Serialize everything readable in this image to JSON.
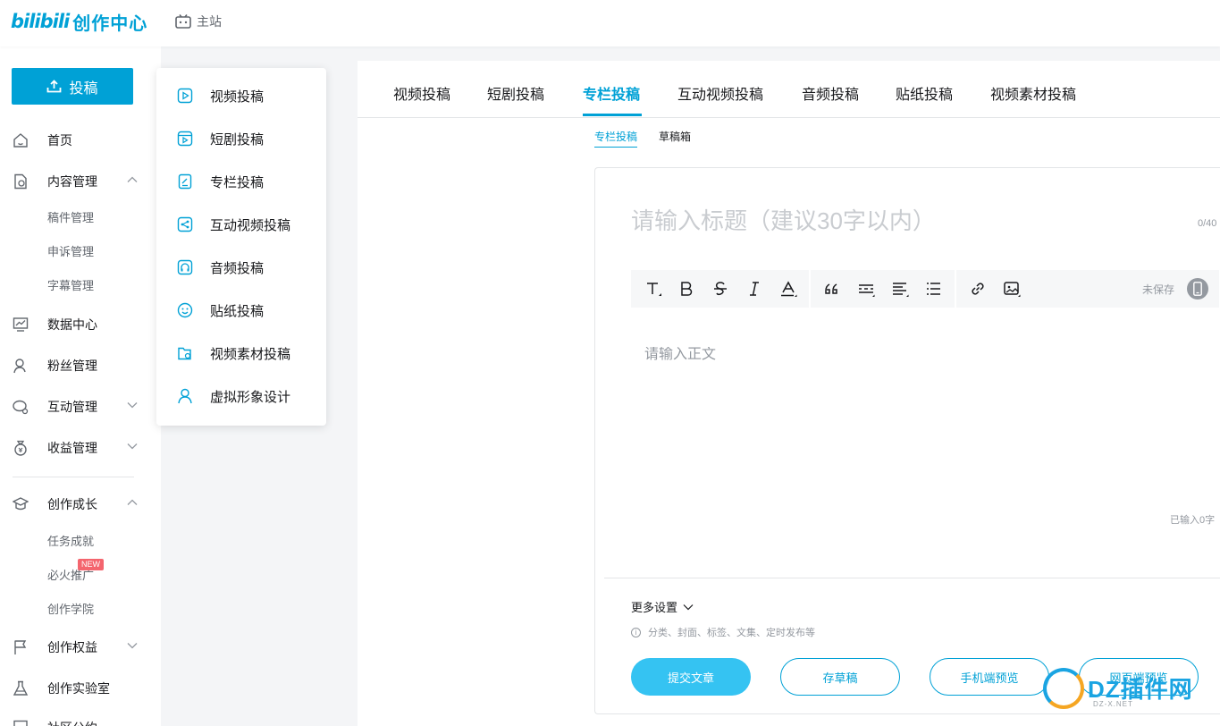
{
  "header": {
    "logo_mark": "bilibili",
    "logo_text": "创作中心",
    "home_label": "主站"
  },
  "sidebar": {
    "upload_label": "投稿",
    "items": [
      {
        "label": "首页"
      },
      {
        "label": "内容管理"
      },
      {
        "label": "数据中心"
      },
      {
        "label": "粉丝管理"
      },
      {
        "label": "互动管理"
      },
      {
        "label": "收益管理"
      },
      {
        "label": "创作成长"
      },
      {
        "label": "创作权益"
      },
      {
        "label": "创作实验室"
      },
      {
        "label": "社区公约"
      }
    ],
    "content_sub": [
      "稿件管理",
      "申诉管理",
      "字幕管理"
    ],
    "growth_sub": [
      "任务成就",
      "必火推广",
      "创作学院"
    ],
    "new_badge": "NEW"
  },
  "dropdown": {
    "items": [
      {
        "label": "视频投稿",
        "icon": "video-icon"
      },
      {
        "label": "短剧投稿",
        "icon": "drama-icon"
      },
      {
        "label": "专栏投稿",
        "icon": "article-icon"
      },
      {
        "label": "互动视频投稿",
        "icon": "share-icon"
      },
      {
        "label": "音频投稿",
        "icon": "headphones-icon"
      },
      {
        "label": "贴纸投稿",
        "icon": "sticker-icon"
      },
      {
        "label": "视频素材投稿",
        "icon": "material-icon"
      },
      {
        "label": "虚拟形象设计",
        "icon": "avatar-icon"
      }
    ]
  },
  "main": {
    "tabs": [
      "视频投稿",
      "短剧投稿",
      "专栏投稿",
      "互动视频投稿",
      "音频投稿",
      "贴纸投稿",
      "视频素材投稿"
    ],
    "active_tab": "专栏投稿",
    "subtabs": [
      "专栏投稿",
      "草稿箱"
    ],
    "editor": {
      "title_placeholder": "请输入标题（建议30字以内）",
      "title_count": "0/40",
      "unsaved": "未保存",
      "body_placeholder": "请输入正文",
      "word_count": "已输入0字",
      "more_settings": "更多设置",
      "settings_hint": "分类、封面、标签、文集、定时发布等"
    },
    "buttons": {
      "submit": "提交文章",
      "save_draft": "存草稿",
      "mobile_preview": "手机端预览",
      "pc_preview": "网页端预览"
    }
  },
  "watermark": {
    "text": "DZ插件网",
    "sub": "DZ-X.NET"
  },
  "colors": {
    "accent": "#00a1d6",
    "button_primary": "#35c3f2",
    "badge": "#f4656e"
  }
}
